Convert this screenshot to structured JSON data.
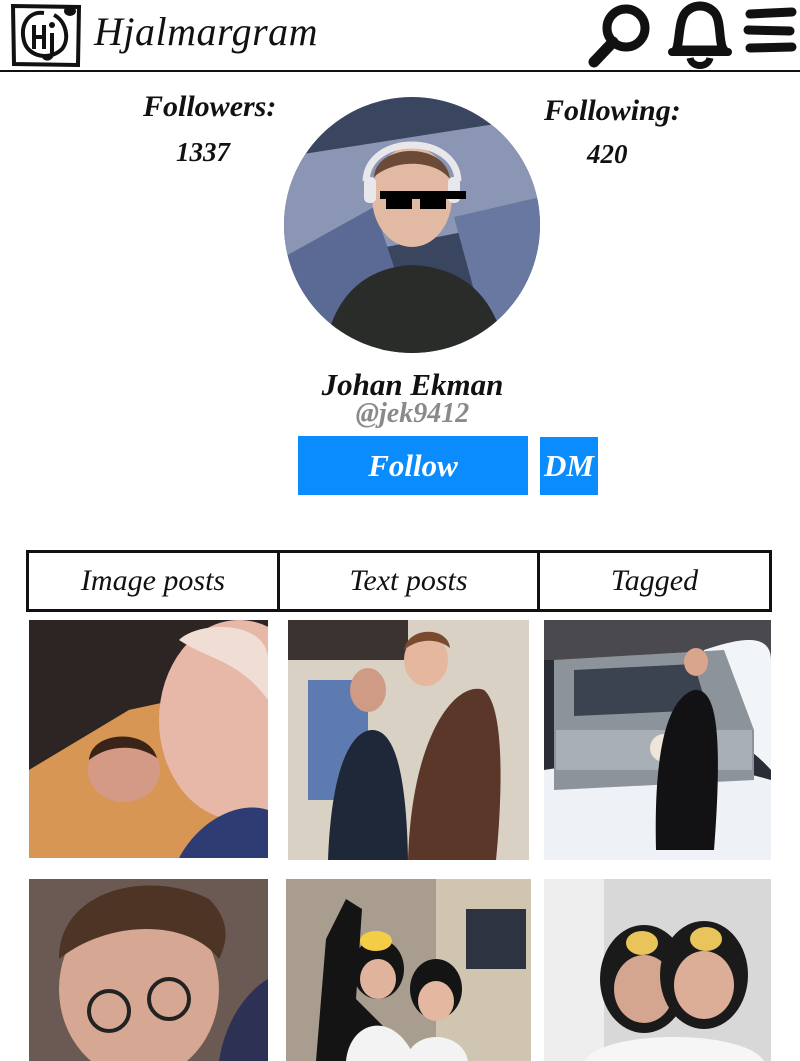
{
  "header": {
    "app_title": "Hjalmargram",
    "logo_icon": "hjalmargram-logo-icon",
    "icons": [
      "search-icon",
      "bell-icon",
      "menu-icon"
    ]
  },
  "profile": {
    "followers_label": "Followers:",
    "followers_count": "1337",
    "following_label": "Following:",
    "following_count": "420",
    "name": "Johan Ekman",
    "handle": "@jek9412",
    "follow_label": "Follow",
    "dm_label": "DM"
  },
  "tabs": [
    {
      "label": "Image posts"
    },
    {
      "label": "Text posts"
    },
    {
      "label": "Tagged"
    }
  ],
  "colors": {
    "accent": "#0a8cff",
    "handle": "#8a8a8a",
    "text": "#111111"
  }
}
